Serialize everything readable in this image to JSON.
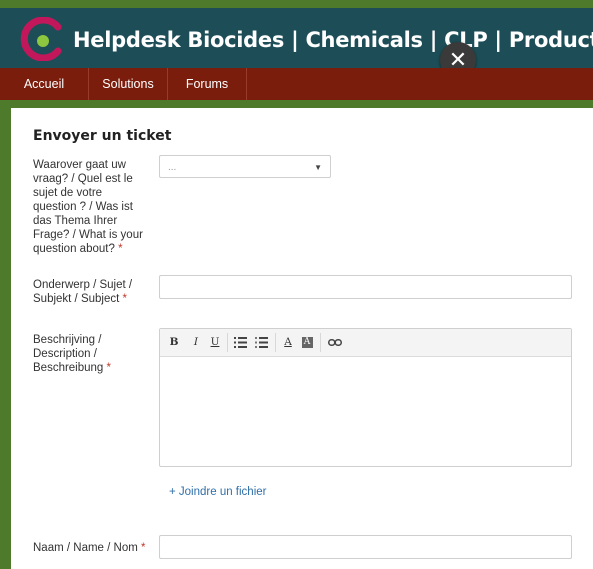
{
  "header": {
    "site_title": "Helpdesk Biocides | Chemicals | CLP | Products",
    "close_symbol": "✕",
    "colors": {
      "header_bg": "#1d4e57",
      "nav_bg": "#7a1d0c",
      "accent_green": "#4e7a2c"
    }
  },
  "nav": {
    "items": [
      {
        "label": "Accueil"
      },
      {
        "label": "Solutions"
      },
      {
        "label": "Forums"
      }
    ]
  },
  "form": {
    "title": "Envoyer un ticket",
    "topic": {
      "label_lines": [
        "Waarover gaat uw",
        "vraag? / Quel est le",
        "sujet de votre",
        "question ? / Was ist",
        "das Thema Ihrer",
        "Frage? / What is your",
        "question about?"
      ],
      "required_mark": "*",
      "value": "...",
      "caret": "▼"
    },
    "subject": {
      "label_lines": [
        "Onderwerp / Sujet /",
        "Subjekt / Subject"
      ],
      "required_mark": "*",
      "value": ""
    },
    "description": {
      "label_lines": [
        "Beschrijving /",
        "Description /",
        "Beschreibung"
      ],
      "required_mark": "*",
      "toolbar": {
        "bold": "B",
        "italic": "I",
        "underline": "U",
        "text_color": "A",
        "bg_color": "A",
        "icons": [
          "bold-icon",
          "italic-icon",
          "underline-icon",
          "bullet-list-icon",
          "numbered-list-icon",
          "text-color-icon",
          "background-color-icon",
          "link-icon"
        ]
      },
      "value": ""
    },
    "attach_label": "+ Joindre un fichier",
    "name": {
      "label": "Naam / Name / Nom",
      "required_mark": "*",
      "value": ""
    }
  }
}
